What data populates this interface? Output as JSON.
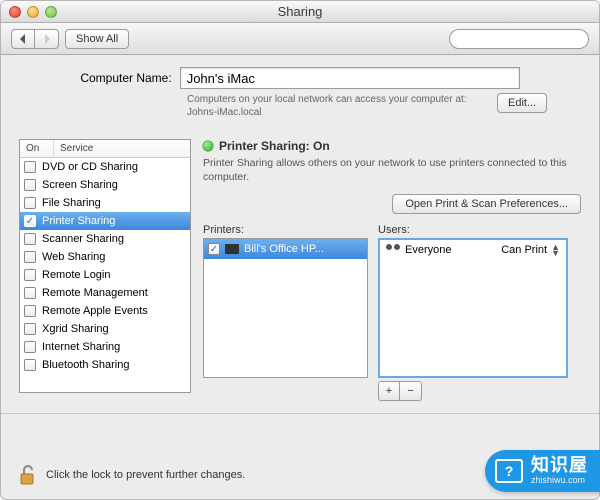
{
  "window": {
    "title": "Sharing"
  },
  "toolbar": {
    "show_all": "Show All"
  },
  "computer_name": {
    "label": "Computer Name:",
    "value": "John's iMac",
    "hint": "Computers on your local network can access your computer at: Johns-iMac.local",
    "edit": "Edit..."
  },
  "services": {
    "col_on": "On",
    "col_service": "Service",
    "items": [
      {
        "label": "DVD or CD Sharing",
        "on": false
      },
      {
        "label": "Screen Sharing",
        "on": false
      },
      {
        "label": "File Sharing",
        "on": false
      },
      {
        "label": "Printer Sharing",
        "on": true,
        "selected": true
      },
      {
        "label": "Scanner Sharing",
        "on": false
      },
      {
        "label": "Web Sharing",
        "on": false
      },
      {
        "label": "Remote Login",
        "on": false
      },
      {
        "label": "Remote Management",
        "on": false
      },
      {
        "label": "Remote Apple Events",
        "on": false
      },
      {
        "label": "Xgrid Sharing",
        "on": false
      },
      {
        "label": "Internet Sharing",
        "on": false
      },
      {
        "label": "Bluetooth Sharing",
        "on": false
      }
    ]
  },
  "detail": {
    "status": "Printer Sharing: On",
    "description": "Printer Sharing allows others on your network to use printers connected to this computer.",
    "pref_button": "Open Print & Scan Preferences...",
    "printers_label": "Printers:",
    "users_label": "Users:",
    "printers": [
      {
        "label": "Bill's Office HP...",
        "checked": true
      }
    ],
    "users": [
      {
        "name": "Everyone",
        "perm": "Can Print"
      }
    ]
  },
  "lock": {
    "text": "Click the lock to prevent further changes."
  },
  "watermark": {
    "big": "知识屋",
    "small": "zhishiwu.com"
  }
}
